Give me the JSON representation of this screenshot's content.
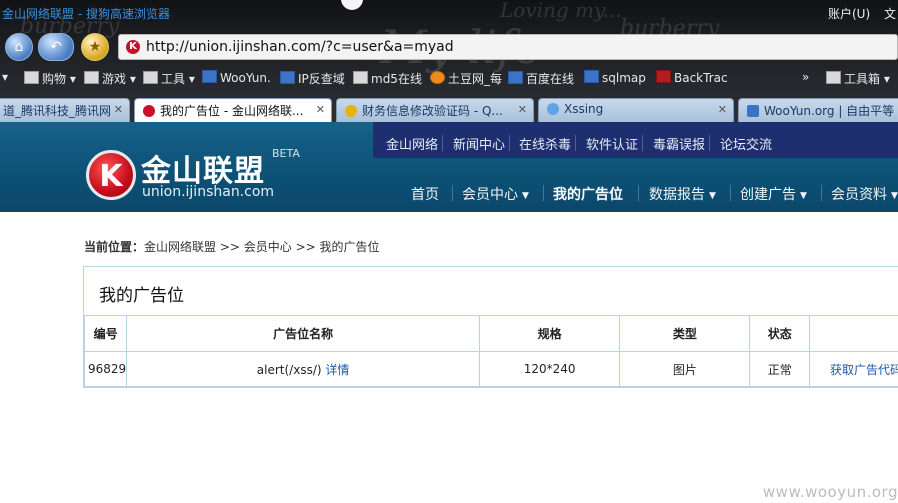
{
  "browser": {
    "window_title": "金山网络联盟 - 搜狗高速浏览器",
    "account_label": "账户(U)",
    "extra_label": "文",
    "address_url": "http://union.ijinshan.com/?c=user&a=myad",
    "bookmarks": [
      "购物",
      "游戏",
      "工具",
      "WooYun.",
      "IP反查域",
      "md5在线",
      "土豆网_每",
      "百度在线",
      "sqlmap",
      "BackTrac",
      "工具箱"
    ],
    "tabs": [
      {
        "label": "道_腾讯科技_腾讯网",
        "active": false
      },
      {
        "label": "我的广告位 - 金山网络联...",
        "active": true
      },
      {
        "label": "财务信息修改验证码 - Q...",
        "active": false
      },
      {
        "label": "Xssing",
        "active": false
      },
      {
        "label": "WooYun.org | 自由平等",
        "active": false
      }
    ]
  },
  "site": {
    "top_nav": [
      "金山网络",
      "新闻中心",
      "在线杀毒",
      "软件认证",
      "毒霸误报",
      "论坛交流"
    ],
    "logo": {
      "k": "K",
      "name": "金山联盟",
      "beta": "BETA",
      "domain": "union.ijinshan.com"
    },
    "main_nav": [
      {
        "label": "首页",
        "dropdown": false,
        "current": false
      },
      {
        "label": "会员中心",
        "dropdown": true,
        "current": false
      },
      {
        "label": "我的广告位",
        "dropdown": false,
        "current": true
      },
      {
        "label": "数据报告",
        "dropdown": true,
        "current": false
      },
      {
        "label": "创建广告",
        "dropdown": true,
        "current": false
      },
      {
        "label": "会员资料",
        "dropdown": true,
        "current": false
      }
    ]
  },
  "breadcrumb": {
    "prefix": "当前位置：",
    "path": "金山网络联盟 >> 会员中心 >> 我的广告位"
  },
  "panel": {
    "title": "我的广告位",
    "columns": [
      "编号",
      "广告位名称",
      "规格",
      "类型",
      "状态",
      ""
    ],
    "rows": [
      {
        "id": "96829",
        "name": "alert(/xss/)",
        "detail_link": "详情",
        "size": "120*240",
        "type": "图片",
        "status": "正常",
        "action": "获取广告代码"
      }
    ]
  },
  "watermark": "www.wooyun.org",
  "colors": {
    "header_blue": "#0d5277",
    "top_nav_bg": "#1d2f6e",
    "logo_red": "#c40d1d",
    "link_blue": "#1b5aa6",
    "border": "#b8d3e6"
  }
}
